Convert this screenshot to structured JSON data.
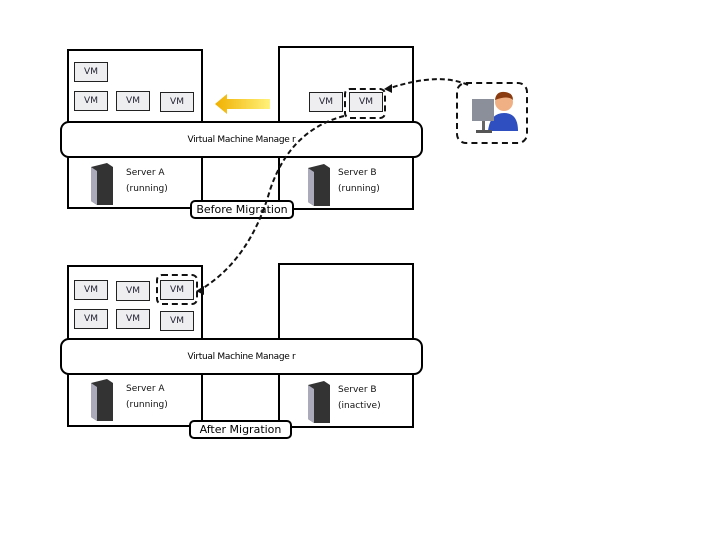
{
  "vm_label": "VM",
  "vmm_label": "Virtual Machine Manage r",
  "before": {
    "stage_label": "Before Migration",
    "server_a": {
      "name": "Server A",
      "status": "(running)"
    },
    "server_b": {
      "name": "Server B",
      "status": "(running)"
    }
  },
  "after": {
    "stage_label": "After Migration",
    "server_a": {
      "name": "Server A",
      "status": "(running)"
    },
    "server_b": {
      "name": "Server B",
      "status": "(inactive)"
    }
  },
  "colors": {
    "arrow": "#f5c400",
    "vm_fill": "#eeeef0"
  },
  "icons": [
    "server-tower-icon",
    "administrator-icon",
    "migration-arrow-icon"
  ]
}
